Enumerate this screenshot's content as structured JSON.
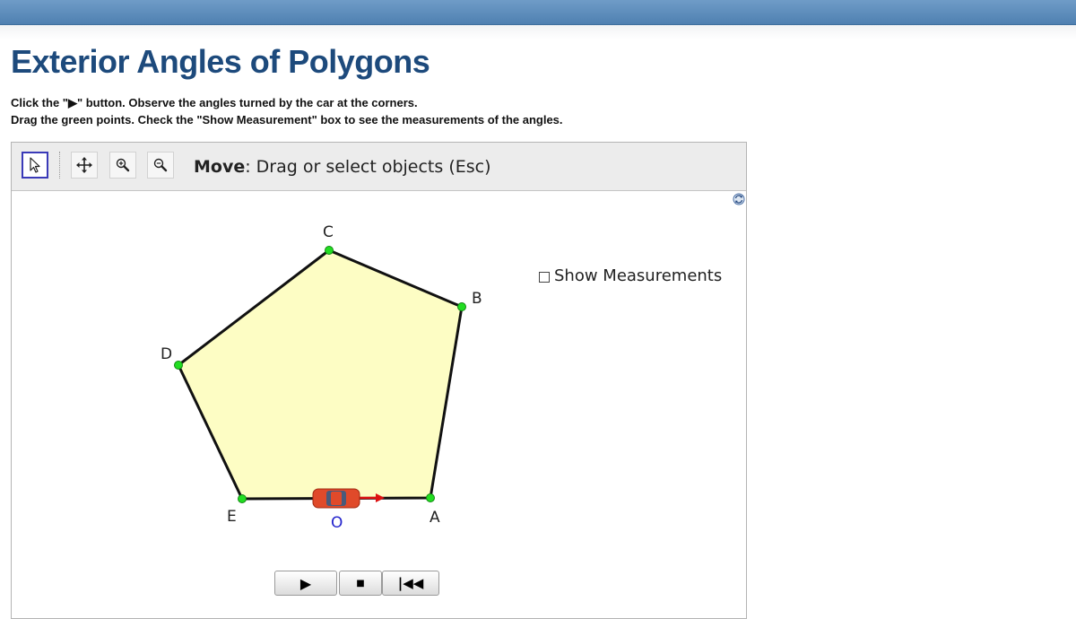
{
  "page": {
    "title": "Exterior Angles of Polygons",
    "instruction_1": "Click the \"▶\" button. Observe the angles turned by the car at the corners.",
    "instruction_2": "Drag the green points. Check the \"Show Measurement\" box to see the measurements of the angles."
  },
  "toolbar": {
    "tools": [
      {
        "name": "move",
        "icon": "cursor-arrow-icon",
        "selected": true
      },
      {
        "name": "move-graphics-view",
        "icon": "move-cross-icon"
      },
      {
        "name": "zoom-in",
        "icon": "zoom-in-icon"
      },
      {
        "name": "zoom-out",
        "icon": "zoom-out-icon"
      }
    ],
    "help_tool_name": "Move",
    "help_text": ": Drag or select objects (Esc)"
  },
  "graphics": {
    "show_measurements_label": "Show Measurements",
    "show_measurements_checked": false,
    "polygon_fill": "#fdfdc4",
    "point_color": "#22dd22",
    "point_labels": {
      "A": "A",
      "B": "B",
      "C": "C",
      "D": "D",
      "E": "E",
      "O": "O"
    },
    "car_color": "#e04a2a"
  },
  "controls": {
    "play_icon": "▶",
    "stop_icon": "■",
    "rewind_icon": "|◀◀"
  },
  "colors": {
    "title": "#1d4a7c",
    "topbar": "#5b8bbd",
    "label_O": "#2222cc"
  }
}
